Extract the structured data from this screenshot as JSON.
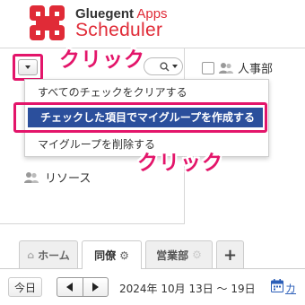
{
  "brand": {
    "name": "Gluegent",
    "suffix": "Apps",
    "product": "Scheduler"
  },
  "annotations": {
    "click_label_1": "クリック",
    "click_label_2": "クリック",
    "highlight_color": "#e3156a"
  },
  "group_panel": {
    "first_group_label": "人事部",
    "resource_label": "リソース"
  },
  "dropdown_menu": {
    "items": [
      {
        "label": "すべてのチェックをクリアする",
        "selected": false
      },
      {
        "label": "チェックした項目でマイグループを作成する",
        "selected": true
      },
      {
        "label": "マイグループを削除する",
        "selected": false
      }
    ],
    "selected_color": "#2b4f9c"
  },
  "tabs": [
    {
      "label": "ホーム",
      "icon": "home-icon",
      "active": false
    },
    {
      "label": "同僚",
      "icon": "gear-icon",
      "active": true
    },
    {
      "label": "営業部",
      "icon": "gear-icon",
      "active": false
    },
    {
      "label": "+",
      "icon": "plus-icon",
      "active": false
    }
  ],
  "date_nav": {
    "today_label": "今日",
    "range": "2024年 10月 13日 〜 19日",
    "calendar_link": "カ"
  },
  "colors": {
    "brand_red": "#e02b37"
  }
}
